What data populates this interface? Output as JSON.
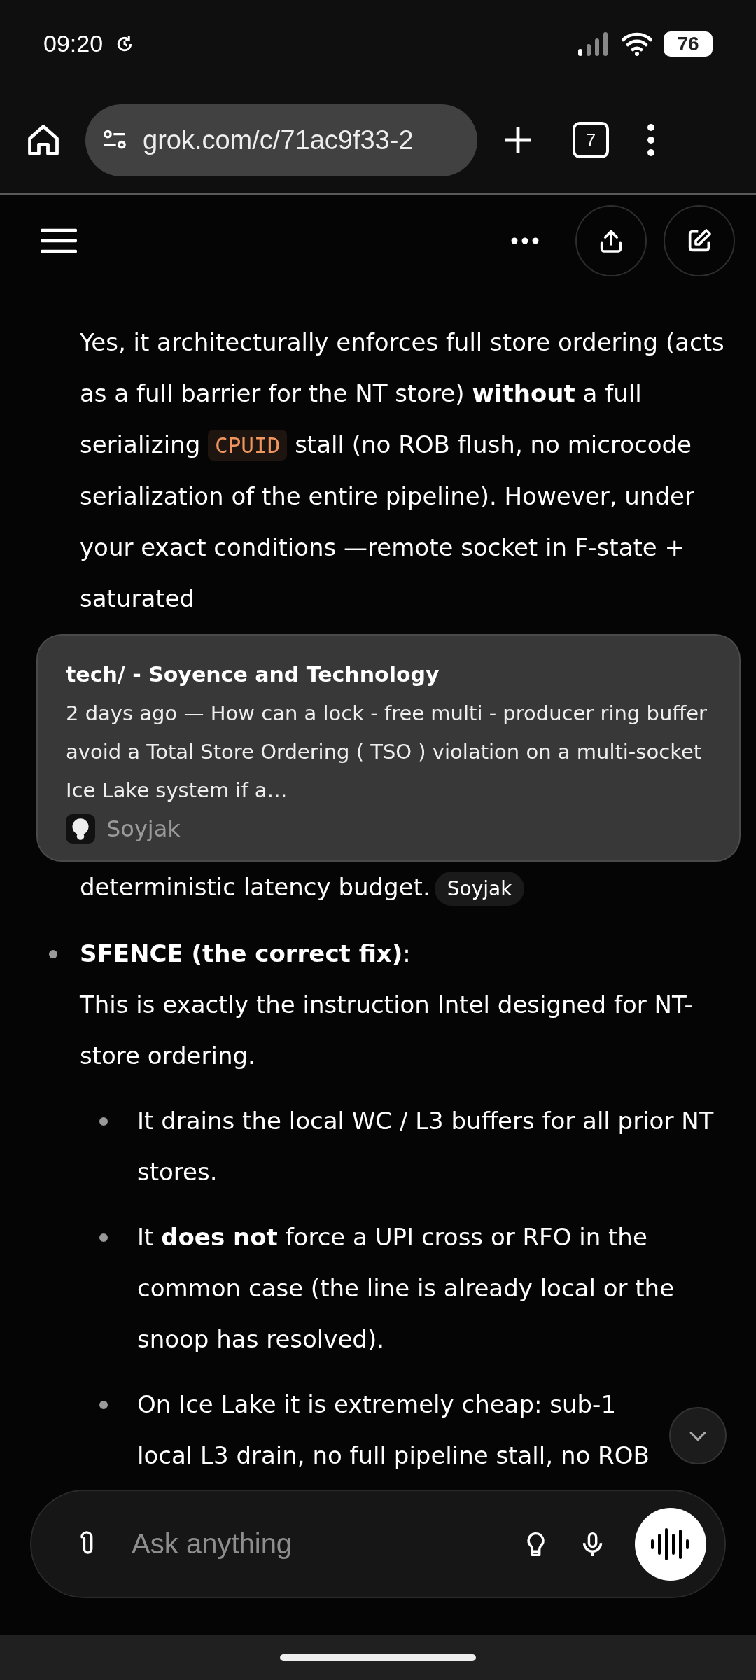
{
  "status_bar": {
    "time": "09:20",
    "battery": "76"
  },
  "browser": {
    "url": "grok.com/c/71ac9f33-2",
    "tab_count": "7"
  },
  "answer": {
    "paragraph": [
      {
        "kind": "text",
        "text": "Yes, it architecturally enforces full store ordering (acts as a full barrier for the NT store) **without** a full serializing "
      },
      {
        "kind": "code",
        "text": "CPUID"
      },
      {
        "kind": "text",
        "text": " stall (no ROB flush, no microcode serialization of the entire pipeline). However, under your exact conditions —remote socket in F-state + saturated"
      }
    ],
    "source_card": {
      "title": "tech/ - Soyence and Technology",
      "snippet": "2 days ago — How can a lock - free multi - producer ring buffer avoid a Total Store Ordering ( TSO ) violation on a multi-socket Ice Lake system if a…",
      "source": "Soyjak"
    },
    "tail": {
      "text": "deterministic latency budget.",
      "citation": "Soyjak"
    },
    "bullets": [
      {
        "title": "**SFENCE (the correct fix)**:",
        "body": "This is exactly the instruction Intel designed for NT-store ordering.",
        "children": [
          {
            "text": "It drains the local WC / L3 buffers for all prior NT stores."
          },
          {
            "text": "It **does not** force a UPI cross or RFO in the common case (the line is already local or the snoop has resolved)."
          },
          {
            "lines": [
              "On Ice Lake it is extremely cheap: sub-1",
              "local L3 drain, no full pipeline stall, no ROB"
            ]
          }
        ]
      }
    ]
  },
  "composer": {
    "placeholder": "Ask anything"
  }
}
